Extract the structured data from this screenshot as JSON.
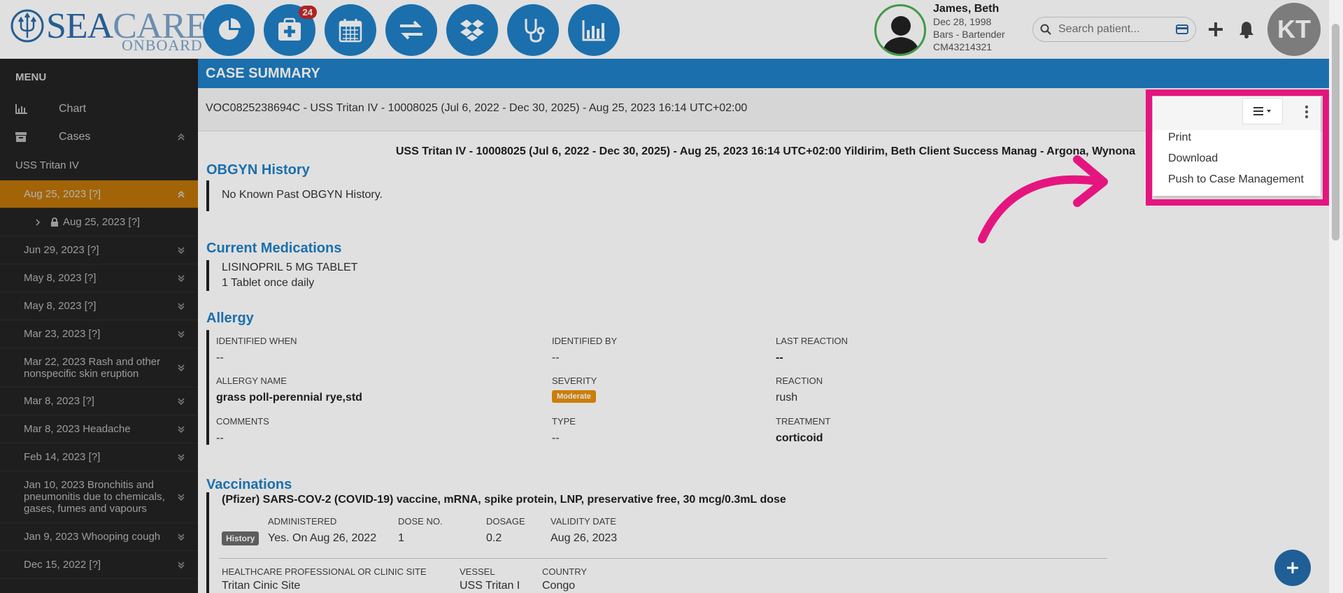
{
  "logo": {
    "sea": "SEA",
    "care": "CARE",
    "sub": "ONBOARD"
  },
  "nav": [
    {
      "name": "dashboard-button",
      "icon": "pie-chart-icon"
    },
    {
      "name": "new-case-button",
      "icon": "medical-plus-icon",
      "badge": "24"
    },
    {
      "name": "calendar-button",
      "icon": "calendar-icon"
    },
    {
      "name": "transfer-button",
      "icon": "exchange-icon"
    },
    {
      "name": "dropbox-button",
      "icon": "dropbox-icon"
    },
    {
      "name": "clinical-button",
      "icon": "stethoscope-icon"
    },
    {
      "name": "reports-button",
      "icon": "bar-chart-icon"
    }
  ],
  "patient": {
    "name": "James, Beth",
    "dob": "Dec 28, 1998",
    "role": "Bars - Bartender",
    "id": "CM43214321"
  },
  "search": {
    "placeholder": "Search patient..."
  },
  "user": {
    "initials": "KT"
  },
  "sidebar": {
    "menu_title": "MENU",
    "chart_label": "Chart",
    "cases_label": "Cases",
    "vessel": "USS Tritan IV",
    "active_case": "Aug 25, 2023 [?]",
    "sub_case": "Aug 25, 2023 [?]",
    "cases": [
      "Jun 29, 2023 [?]",
      "May 8, 2023 [?]",
      "May 8, 2023 [?]",
      "Mar 23, 2023 [?]",
      "Mar 22, 2023 Rash and other nonspecific skin eruption",
      "Mar 8, 2023 [?]",
      "Mar 8, 2023 Headache",
      "Feb 14, 2023 [?]",
      "Jan 10, 2023 Bronchitis and pneumonitis due to chemicals, gases, fumes and vapours",
      "Jan 9, 2023 Whooping cough",
      "Dec 15, 2022 [?]"
    ]
  },
  "main": {
    "header": "CASE SUMMARY",
    "subheader": "VOC0825238694C - USS Tritan IV - 10008025 (Jul 6, 2022 - Dec 30, 2025) - Aug 25, 2023 16:14 UTC+02:00",
    "summary_line": "USS Tritan IV - 10008025 (Jul 6, 2022 - Dec 30, 2025) - Aug 25, 2023 16:14 UTC+02:00 Yildirim, Beth Client Success Manag - Argona, Wynona",
    "obgyn": {
      "title": "OBGYN History",
      "text": "No Known Past OBGYN History."
    },
    "medications": {
      "title": "Current Medications",
      "name": "LISINOPRIL 5 MG TABLET",
      "dose": "1 Tablet once daily"
    },
    "allergy": {
      "title": "Allergy",
      "identified_when_label": "IDENTIFIED WHEN",
      "identified_when": "--",
      "identified_by_label": "IDENTIFIED BY",
      "identified_by": "--",
      "last_reaction_label": "LAST REACTION",
      "last_reaction": "--",
      "name_label": "ALLERGY NAME",
      "name": "grass poll-perennial rye,std",
      "severity_label": "SEVERITY",
      "severity": "Moderate",
      "reaction_label": "REACTION",
      "reaction": "rush",
      "comments_label": "COMMENTS",
      "comments": "--",
      "type_label": "TYPE",
      "type": "--",
      "treatment_label": "TREATMENT",
      "treatment": "corticoid"
    },
    "vaccinations": {
      "title": "Vaccinations",
      "vaccine": "(Pfizer) SARS-COV-2 (COVID-19) vaccine, mRNA, spike protein, LNP, preservative free, 30 mcg/0.3mL dose",
      "history_badge": "History",
      "administered_label": "ADMINISTERED",
      "administered": "Yes. On Aug 26, 2022",
      "dose_no_label": "DOSE NO.",
      "dose_no": "1",
      "dosage_label": "DOSAGE",
      "dosage": "0.2",
      "validity_label": "VALIDITY DATE",
      "validity": "Aug 26, 2023",
      "site_label": "HEALTHCARE PROFESSIONAL OR CLINIC SITE",
      "site": "Tritan Cinic Site",
      "vessel_label": "VESSEL",
      "vessel": "USS Tritan I",
      "country_label": "COUNTRY",
      "country": "Congo"
    }
  },
  "actions_menu": {
    "items": [
      "Print",
      "Download",
      "Push to Case Management"
    ]
  },
  "colors": {
    "primary": "#1f7fc4",
    "active": "#e8900a",
    "highlight": "#e5157f",
    "sidebar": "#2c2c2c"
  }
}
